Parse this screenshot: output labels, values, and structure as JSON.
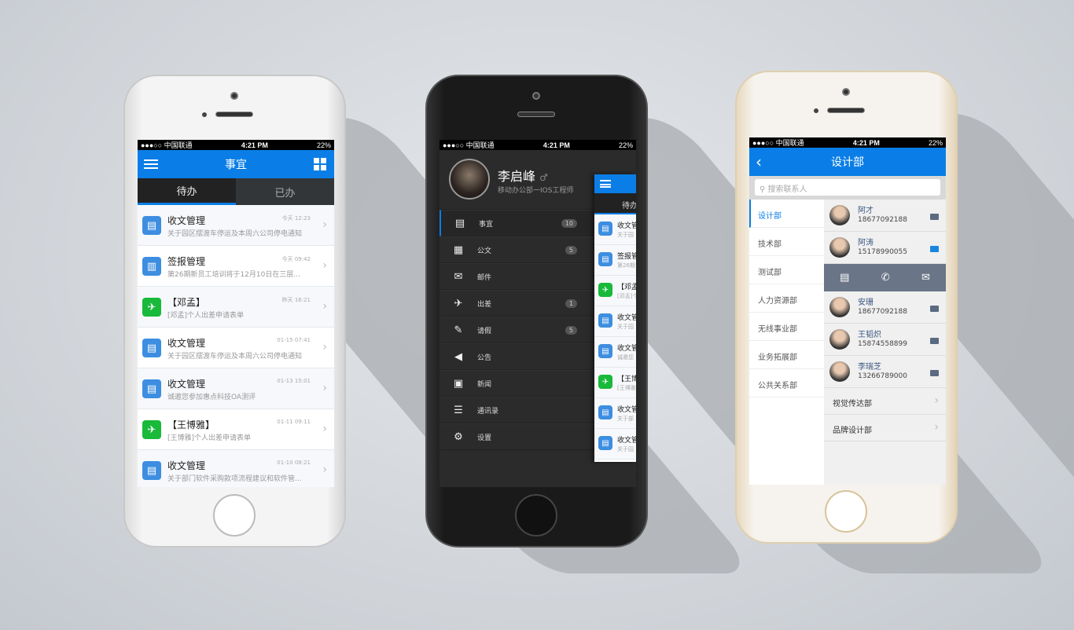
{
  "status": {
    "carrier": "●●●○○ 中国联通",
    "time": "4:21 PM",
    "battery": "22%"
  },
  "colors": {
    "accent": "#0a7ee6",
    "green": "#19b93a"
  },
  "phone1": {
    "title": "事宜",
    "tabs": [
      "待办",
      "已办"
    ],
    "items": [
      {
        "title": "收文管理",
        "sub": "关于园区摆渡车停运及本周六公司停电通知",
        "time": "今天  12:23",
        "icon": "document-icon"
      },
      {
        "title": "签报管理",
        "sub": "第26期新员工培训将于12月10日在三层...",
        "time": "今天  09:42",
        "icon": "report-icon"
      },
      {
        "title": "【邓孟】",
        "sub": "[邓孟]个人出差申请表单",
        "time": "昨天  16:21",
        "icon": "plane-icon"
      },
      {
        "title": "收文管理",
        "sub": "关于园区摆渡车停运及本周六公司停电通知",
        "time": "01-15  07:41",
        "icon": "document-icon"
      },
      {
        "title": "收文管理",
        "sub": "诚邀您参加惠点科技OA测评",
        "time": "01-13  15:01",
        "icon": "document-icon"
      },
      {
        "title": "【王博雅】",
        "sub": "[王博雅]个人出差申请表单",
        "time": "01-11  09:11",
        "icon": "plane-icon"
      },
      {
        "title": "收文管理",
        "sub": "关于部门软件采购款项流程建议和软件管...",
        "time": "01-10  08:21",
        "icon": "document-icon"
      }
    ]
  },
  "phone2": {
    "name": "李启峰",
    "gender": "♂",
    "role": "移动办公部一IOS工程师",
    "menu": [
      {
        "label": "事宜",
        "badge": "10",
        "icon": "document-icon"
      },
      {
        "label": "公文",
        "badge": "5",
        "icon": "newspaper-icon"
      },
      {
        "label": "邮件",
        "badge": "",
        "icon": "mail-icon"
      },
      {
        "label": "出差",
        "badge": "1",
        "icon": "plane-icon"
      },
      {
        "label": "请假",
        "badge": "5",
        "icon": "edit-icon"
      },
      {
        "label": "公告",
        "badge": "",
        "icon": "megaphone-icon"
      },
      {
        "label": "新闻",
        "badge": "",
        "icon": "news-icon"
      },
      {
        "label": "通讯录",
        "badge": "",
        "icon": "contacts-icon"
      },
      {
        "label": "设置",
        "badge": "",
        "icon": "gear-icon"
      }
    ],
    "mini_tab": "待办",
    "mini_items": [
      {
        "t": "收文管",
        "s": "关于园",
        "g": false
      },
      {
        "t": "签报管",
        "s": "第26期",
        "g": false
      },
      {
        "t": "【邓孟",
        "s": "[邓孟]个",
        "g": true
      },
      {
        "t": "收文管",
        "s": "关于园",
        "g": false
      },
      {
        "t": "收文管",
        "s": "诚邀您",
        "g": false
      },
      {
        "t": "【王博",
        "s": "[王博雅",
        "g": true
      },
      {
        "t": "收文管",
        "s": "关于部",
        "g": false
      },
      {
        "t": "收文管",
        "s": "关于园",
        "g": false
      }
    ]
  },
  "phone3": {
    "title": "设计部",
    "search_placeholder": "搜索联系人",
    "departments": [
      "设计部",
      "技术部",
      "测试部",
      "人力资源部",
      "无线事业部",
      "业务拓展部",
      "公共关系部"
    ],
    "contacts_top": [
      {
        "name": "阿才",
        "phone": "18677092188",
        "blue": false
      },
      {
        "name": "阿涛",
        "phone": "15178990055",
        "blue": true
      }
    ],
    "contacts_bottom": [
      {
        "name": "安珊",
        "phone": "18677092188",
        "blue": false
      },
      {
        "name": "王韬炽",
        "phone": "15874558899",
        "blue": false
      },
      {
        "name": "李瑞芝",
        "phone": "13266789000",
        "blue": false
      }
    ],
    "subdepts": [
      "视觉传达部",
      "品牌设计部"
    ]
  }
}
